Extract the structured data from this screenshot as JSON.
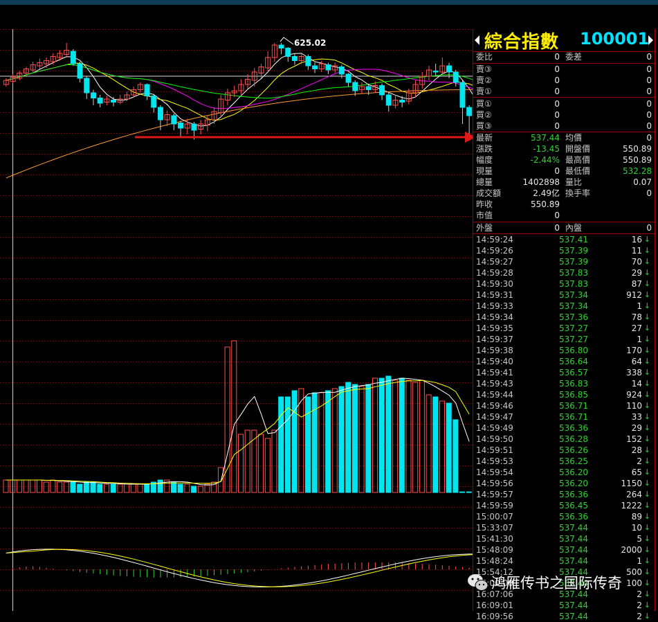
{
  "header": {
    "index_name": "綜合指數",
    "index_code": "100001"
  },
  "chart_annotation": {
    "high_label": "625.02"
  },
  "colors": {
    "up": "#ff5050",
    "down": "#00e5ee",
    "grid": "#7a0000",
    "price_green": "#32d232",
    "title_yellow": "#ffee00",
    "code_cyan": "#00e0ff"
  },
  "book": {
    "ratio_label": "委比",
    "ratio_value": "0",
    "diff_label": "委差",
    "diff_value": "0",
    "asks": [
      {
        "label": "賣③",
        "price": "0",
        "volume": "0"
      },
      {
        "label": "賣②",
        "price": "0",
        "volume": "0"
      },
      {
        "label": "賣①",
        "price": "0",
        "volume": "0"
      }
    ],
    "bids": [
      {
        "label": "買①",
        "price": "0",
        "volume": "0"
      },
      {
        "label": "買②",
        "price": "0",
        "volume": "0"
      },
      {
        "label": "買③",
        "price": "0",
        "volume": "0"
      }
    ]
  },
  "quote": [
    {
      "l1": "最新",
      "v1": "537.44",
      "c1": "green",
      "l2": "均價",
      "v2": "0",
      "c2": "white"
    },
    {
      "l1": "漲跌",
      "v1": "-13.45",
      "c1": "green",
      "l2": "開盤價",
      "v2": "550.89",
      "c2": "white"
    },
    {
      "l1": "幅度",
      "v1": "-2.44%",
      "c1": "green",
      "l2": "最高價",
      "v2": "550.89",
      "c2": "white"
    },
    {
      "l1": "現量",
      "v1": "0",
      "c1": "white",
      "l2": "最低價",
      "v2": "532.28",
      "c2": "green"
    },
    {
      "l1": "總量",
      "v1": "1402898",
      "c1": "white",
      "l2": "量比",
      "v2": "0.07",
      "c2": "white"
    },
    {
      "l1": "成交額",
      "v1": "2.49亿",
      "c1": "white",
      "l2": "換手率",
      "v2": "0",
      "c2": "white"
    },
    {
      "l1": "昨收",
      "v1": "550.89",
      "c1": "white",
      "l2": "",
      "v2": "",
      "c2": "white"
    },
    {
      "l1": "市值",
      "v1": "0",
      "c1": "white",
      "l2": "",
      "v2": "",
      "c2": "white"
    }
  ],
  "outer_inner": {
    "outer_label": "外盤",
    "outer_value": "0",
    "inner_label": "內盤",
    "inner_value": "0"
  },
  "ticks": [
    {
      "time": "14:59:24",
      "price": "537.41",
      "vol": "16"
    },
    {
      "time": "14:59:26",
      "price": "537.39",
      "vol": "11"
    },
    {
      "time": "14:59:27",
      "price": "537.39",
      "vol": "70"
    },
    {
      "time": "14:59:28",
      "price": "537.83",
      "vol": "29"
    },
    {
      "time": "14:59:30",
      "price": "537.83",
      "vol": "87"
    },
    {
      "time": "14:59:31",
      "price": "537.34",
      "vol": "912"
    },
    {
      "time": "14:59:33",
      "price": "537.34",
      "vol": "1"
    },
    {
      "time": "14:59:34",
      "price": "537.36",
      "vol": "78"
    },
    {
      "time": "14:59:35",
      "price": "537.27",
      "vol": "27"
    },
    {
      "time": "14:59:37",
      "price": "537.27",
      "vol": "1"
    },
    {
      "time": "14:59:38",
      "price": "536.80",
      "vol": "170"
    },
    {
      "time": "14:59:40",
      "price": "536.64",
      "vol": "64"
    },
    {
      "time": "14:59:41",
      "price": "536.57",
      "vol": "338"
    },
    {
      "time": "14:59:43",
      "price": "536.83",
      "vol": "14"
    },
    {
      "time": "14:59:44",
      "price": "536.85",
      "vol": "924"
    },
    {
      "time": "14:59:46",
      "price": "536.71",
      "vol": "110"
    },
    {
      "time": "14:59:47",
      "price": "536.71",
      "vol": "33"
    },
    {
      "time": "14:59:49",
      "price": "536.36",
      "vol": "29"
    },
    {
      "time": "14:59:50",
      "price": "536.28",
      "vol": "152"
    },
    {
      "time": "14:59:51",
      "price": "536.26",
      "vol": "28"
    },
    {
      "time": "14:59:53",
      "price": "536.25",
      "vol": "2"
    },
    {
      "time": "14:59:54",
      "price": "536.20",
      "vol": "65"
    },
    {
      "time": "14:59:56",
      "price": "536.20",
      "vol": "1150"
    },
    {
      "time": "14:59:57",
      "price": "536.36",
      "vol": "264"
    },
    {
      "time": "14:59:59",
      "price": "536.45",
      "vol": "1222"
    },
    {
      "time": "15:00:07",
      "price": "536.36",
      "vol": "89"
    },
    {
      "time": "15:33:07",
      "price": "537.44",
      "vol": "10"
    },
    {
      "time": "15:41:30",
      "price": "537.44",
      "vol": "5"
    },
    {
      "time": "15:48:09",
      "price": "537.44",
      "vol": "2000"
    },
    {
      "time": "15:48:24",
      "price": "537.44",
      "vol": "1"
    },
    {
      "time": "15:54:12",
      "price": "537.44",
      "vol": "500"
    },
    {
      "time": "16:00:00",
      "price": "537.44",
      "vol": "100"
    },
    {
      "time": "16:07:06",
      "price": "537.44",
      "vol": "2"
    },
    {
      "time": "16:09:01",
      "price": "537.44",
      "vol": "2"
    },
    {
      "time": "16:09:56",
      "price": "537.44",
      "vol": "2"
    }
  ],
  "watermark": "鸿雁传书之国际传奇",
  "chart_data": {
    "type": "candlestick",
    "high_marker": 625.02,
    "candles": [
      {
        "o": 0.6,
        "c": 0.64,
        "h": 0.66,
        "l": 0.58
      },
      {
        "o": 0.63,
        "c": 0.67,
        "h": 0.7,
        "l": 0.61
      },
      {
        "o": 0.66,
        "c": 0.71,
        "h": 0.73,
        "l": 0.64
      },
      {
        "o": 0.71,
        "c": 0.75,
        "h": 0.77,
        "l": 0.68
      },
      {
        "o": 0.74,
        "c": 0.79,
        "h": 0.82,
        "l": 0.72
      },
      {
        "o": 0.78,
        "c": 0.81,
        "h": 0.85,
        "l": 0.75
      },
      {
        "o": 0.8,
        "c": 0.83,
        "h": 0.86,
        "l": 0.76
      },
      {
        "o": 0.82,
        "c": 0.87,
        "h": 0.9,
        "l": 0.79
      },
      {
        "o": 0.86,
        "c": 0.9,
        "h": 0.93,
        "l": 0.83
      },
      {
        "o": 0.89,
        "c": 0.93,
        "h": 1.0,
        "l": 0.86
      },
      {
        "o": 0.92,
        "c": 0.8,
        "h": 0.94,
        "l": 0.78
      },
      {
        "o": 0.8,
        "c": 0.66,
        "h": 0.82,
        "l": 0.62
      },
      {
        "o": 0.66,
        "c": 0.52,
        "h": 0.68,
        "l": 0.46
      },
      {
        "o": 0.52,
        "c": 0.47,
        "h": 0.55,
        "l": 0.4
      },
      {
        "o": 0.47,
        "c": 0.42,
        "h": 0.5,
        "l": 0.38
      },
      {
        "o": 0.43,
        "c": 0.46,
        "h": 0.49,
        "l": 0.4
      },
      {
        "o": 0.45,
        "c": 0.43,
        "h": 0.48,
        "l": 0.39
      },
      {
        "o": 0.43,
        "c": 0.46,
        "h": 0.5,
        "l": 0.41
      },
      {
        "o": 0.46,
        "c": 0.5,
        "h": 0.53,
        "l": 0.44
      },
      {
        "o": 0.5,
        "c": 0.55,
        "h": 0.58,
        "l": 0.48
      },
      {
        "o": 0.55,
        "c": 0.6,
        "h": 0.62,
        "l": 0.52
      },
      {
        "o": 0.6,
        "c": 0.49,
        "h": 0.61,
        "l": 0.45
      },
      {
        "o": 0.49,
        "c": 0.38,
        "h": 0.51,
        "l": 0.33
      },
      {
        "o": 0.38,
        "c": 0.26,
        "h": 0.4,
        "l": 0.16
      },
      {
        "o": 0.26,
        "c": 0.31,
        "h": 0.35,
        "l": 0.2
      },
      {
        "o": 0.3,
        "c": 0.22,
        "h": 0.32,
        "l": 0.16
      },
      {
        "o": 0.23,
        "c": 0.18,
        "h": 0.25,
        "l": 0.1
      },
      {
        "o": 0.18,
        "c": 0.22,
        "h": 0.27,
        "l": 0.12
      },
      {
        "o": 0.22,
        "c": 0.16,
        "h": 0.24,
        "l": 0.07
      },
      {
        "o": 0.17,
        "c": 0.22,
        "h": 0.26,
        "l": 0.12
      },
      {
        "o": 0.21,
        "c": 0.26,
        "h": 0.3,
        "l": 0.15
      },
      {
        "o": 0.26,
        "c": 0.34,
        "h": 0.38,
        "l": 0.22
      },
      {
        "o": 0.33,
        "c": 0.46,
        "h": 0.5,
        "l": 0.28
      },
      {
        "o": 0.45,
        "c": 0.52,
        "h": 0.56,
        "l": 0.4
      },
      {
        "o": 0.52,
        "c": 0.54,
        "h": 0.59,
        "l": 0.48
      },
      {
        "o": 0.54,
        "c": 0.6,
        "h": 0.65,
        "l": 0.5
      },
      {
        "o": 0.6,
        "c": 0.65,
        "h": 0.7,
        "l": 0.56
      },
      {
        "o": 0.64,
        "c": 0.72,
        "h": 0.76,
        "l": 0.58
      },
      {
        "o": 0.71,
        "c": 0.77,
        "h": 0.8,
        "l": 0.66
      },
      {
        "o": 0.76,
        "c": 0.86,
        "h": 0.92,
        "l": 0.72
      },
      {
        "o": 0.86,
        "c": 0.98,
        "h": 1.0,
        "l": 0.82
      },
      {
        "o": 0.98,
        "c": 0.95,
        "h": 1.0,
        "l": 0.89
      },
      {
        "o": 0.95,
        "c": 0.87,
        "h": 0.96,
        "l": 0.82
      },
      {
        "o": 0.87,
        "c": 0.83,
        "h": 0.9,
        "l": 0.79
      },
      {
        "o": 0.83,
        "c": 0.87,
        "h": 0.9,
        "l": 0.8
      },
      {
        "o": 0.87,
        "c": 0.78,
        "h": 0.89,
        "l": 0.74
      },
      {
        "o": 0.78,
        "c": 0.75,
        "h": 0.81,
        "l": 0.71
      },
      {
        "o": 0.75,
        "c": 0.8,
        "h": 0.83,
        "l": 0.72
      },
      {
        "o": 0.79,
        "c": 0.74,
        "h": 0.81,
        "l": 0.7
      },
      {
        "o": 0.74,
        "c": 0.78,
        "h": 0.81,
        "l": 0.71
      },
      {
        "o": 0.77,
        "c": 0.7,
        "h": 0.79,
        "l": 0.66
      },
      {
        "o": 0.7,
        "c": 0.62,
        "h": 0.71,
        "l": 0.58
      },
      {
        "o": 0.62,
        "c": 0.54,
        "h": 0.64,
        "l": 0.49
      },
      {
        "o": 0.55,
        "c": 0.58,
        "h": 0.62,
        "l": 0.51
      },
      {
        "o": 0.58,
        "c": 0.55,
        "h": 0.61,
        "l": 0.5
      },
      {
        "o": 0.55,
        "c": 0.59,
        "h": 0.63,
        "l": 0.52
      },
      {
        "o": 0.59,
        "c": 0.5,
        "h": 0.61,
        "l": 0.45
      },
      {
        "o": 0.5,
        "c": 0.4,
        "h": 0.52,
        "l": 0.34
      },
      {
        "o": 0.4,
        "c": 0.45,
        "h": 0.5,
        "l": 0.37
      },
      {
        "o": 0.45,
        "c": 0.43,
        "h": 0.49,
        "l": 0.38
      },
      {
        "o": 0.44,
        "c": 0.52,
        "h": 0.56,
        "l": 0.41
      },
      {
        "o": 0.52,
        "c": 0.6,
        "h": 0.64,
        "l": 0.48
      },
      {
        "o": 0.6,
        "c": 0.68,
        "h": 0.72,
        "l": 0.56
      },
      {
        "o": 0.68,
        "c": 0.74,
        "h": 0.78,
        "l": 0.64
      },
      {
        "o": 0.73,
        "c": 0.72,
        "h": 0.8,
        "l": 0.68
      },
      {
        "o": 0.72,
        "c": 0.78,
        "h": 0.86,
        "l": 0.69
      },
      {
        "o": 0.78,
        "c": 0.72,
        "h": 0.81,
        "l": 0.66
      },
      {
        "o": 0.72,
        "c": 0.62,
        "h": 0.74,
        "l": 0.58
      },
      {
        "o": 0.62,
        "c": 0.38,
        "h": 0.64,
        "l": 0.22
      },
      {
        "o": 0.38,
        "c": 0.3,
        "h": 0.4,
        "l": 0.12
      },
      {
        "o": 0.3,
        "c": 0.26,
        "h": 0.31,
        "l": 0.24
      }
    ],
    "volume": [
      6,
      6,
      6,
      6,
      6,
      6,
      5,
      6,
      5,
      5,
      5,
      4,
      5,
      5,
      4,
      4,
      4,
      4,
      4,
      4,
      4,
      4,
      5,
      6,
      6,
      5,
      4,
      4,
      3,
      3,
      4,
      5,
      12,
      70,
      73,
      28,
      30,
      30,
      28,
      26,
      30,
      46,
      46,
      49,
      50,
      46,
      48,
      48,
      49,
      50,
      51,
      53,
      52,
      51,
      52,
      55,
      55,
      56,
      54,
      55,
      54,
      53,
      54,
      47,
      46,
      44,
      43,
      35,
      0.3,
      0.3
    ]
  }
}
